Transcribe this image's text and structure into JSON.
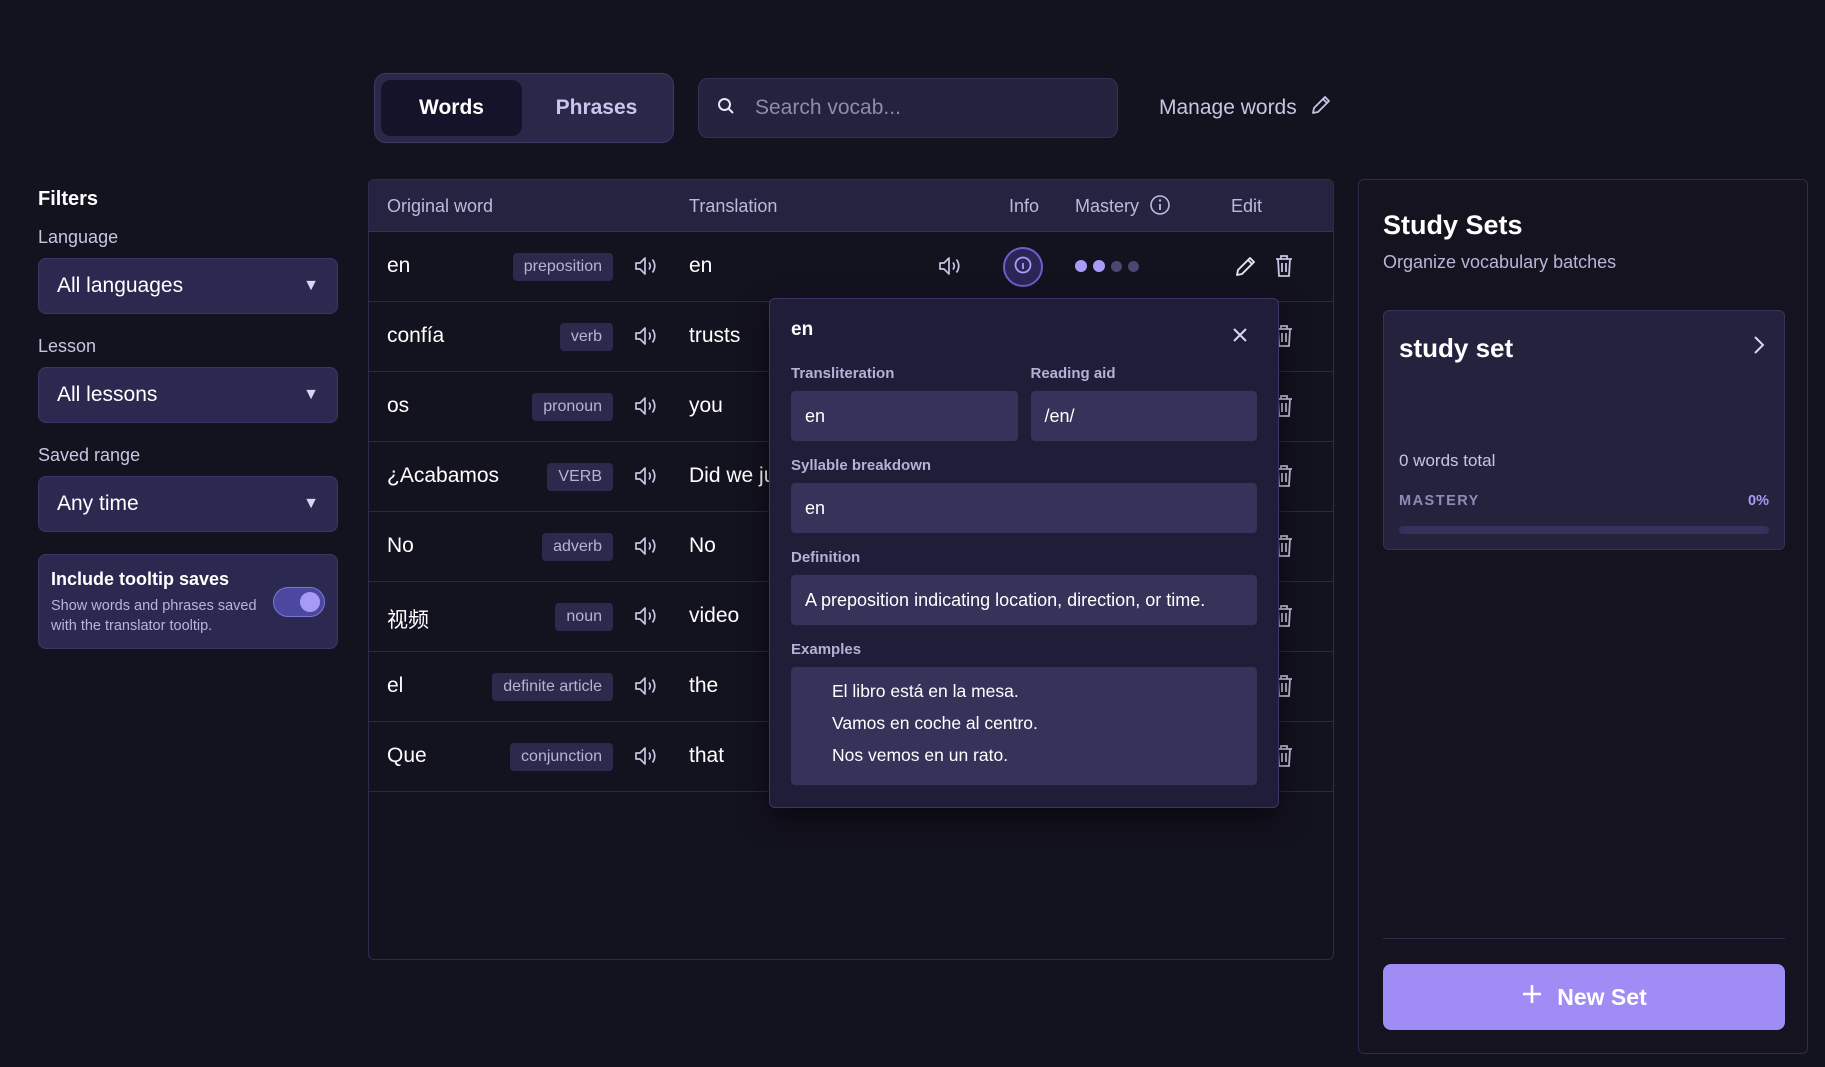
{
  "tabs": [
    {
      "label": "Words",
      "active": true
    },
    {
      "label": "Phrases",
      "active": false
    }
  ],
  "search": {
    "placeholder": "Search vocab..."
  },
  "manage": {
    "label": "Manage words"
  },
  "filters": {
    "title": "Filters",
    "language": {
      "label": "Language",
      "value": "All languages"
    },
    "lesson": {
      "label": "Lesson",
      "value": "All lessons"
    },
    "saved_range": {
      "label": "Saved range",
      "value": "Any time"
    },
    "tooltip": {
      "title": "Include tooltip saves",
      "desc": "Show words and phrases saved with the translator tooltip.",
      "enabled": true
    }
  },
  "table": {
    "headers": {
      "original": "Original word",
      "translation": "Translation",
      "info": "Info",
      "mastery": "Mastery",
      "edit": "Edit"
    },
    "rows": [
      {
        "word": "en",
        "pos": "preposition",
        "translation": "en",
        "mastery": 2
      },
      {
        "word": "confía",
        "pos": "verb",
        "translation": "trusts"
      },
      {
        "word": "os",
        "pos": "pronoun",
        "translation": "you"
      },
      {
        "word": "¿Acabamos",
        "pos": "VERB",
        "translation": "Did we ju"
      },
      {
        "word": "No",
        "pos": "adverb",
        "translation": "No"
      },
      {
        "word": "视频",
        "pos": "noun",
        "translation": "video"
      },
      {
        "word": "el",
        "pos": "definite article",
        "translation": "the"
      },
      {
        "word": "Que",
        "pos": "conjunction",
        "translation": "that"
      }
    ]
  },
  "popover": {
    "title": "en",
    "transliteration_label": "Transliteration",
    "transliteration": "en",
    "reading_aid_label": "Reading aid",
    "reading_aid": "/en/",
    "syllable_label": "Syllable breakdown",
    "syllable": "en",
    "definition_label": "Definition",
    "definition": "A preposition indicating location, direction, or time.",
    "examples_label": "Examples",
    "examples": [
      "El libro está en la mesa.",
      "Vamos en coche al centro.",
      "Nos vemos en un rato."
    ]
  },
  "study_sets": {
    "title": "Study Sets",
    "subtitle": "Organize vocabulary batches",
    "sets": [
      {
        "name": "study set",
        "count": "0 words total",
        "mastery_label": "MASTERY",
        "mastery_pct": "0%",
        "mastery_fraction": 0
      }
    ],
    "new_set_label": "New Set"
  },
  "colors": {
    "accent": "#a08cf5",
    "background": "#13121f",
    "panel": "#24223d"
  }
}
